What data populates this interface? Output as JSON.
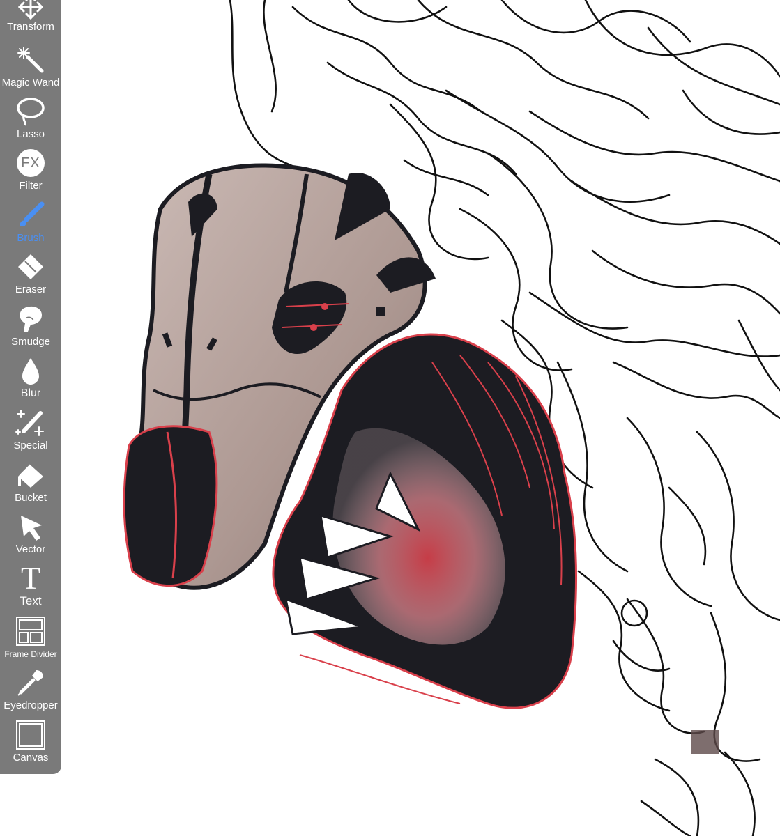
{
  "toolbar": {
    "tools": [
      {
        "label": "Transform",
        "icon": "transform-arrows-icon",
        "active": false
      },
      {
        "label": "Magic Wand",
        "icon": "magic-wand-icon",
        "active": false
      },
      {
        "label": "Lasso",
        "icon": "lasso-icon",
        "active": false
      },
      {
        "label": "Filter",
        "icon": "fx-filter-icon",
        "active": false
      },
      {
        "label": "Brush",
        "icon": "brush-icon",
        "active": true
      },
      {
        "label": "Eraser",
        "icon": "eraser-icon",
        "active": false
      },
      {
        "label": "Smudge",
        "icon": "smudge-finger-icon",
        "active": false
      },
      {
        "label": "Blur",
        "icon": "blur-drop-icon",
        "active": false
      },
      {
        "label": "Special",
        "icon": "special-pen-icon",
        "active": false
      },
      {
        "label": "Bucket",
        "icon": "bucket-icon",
        "active": false
      },
      {
        "label": "Vector",
        "icon": "vector-arrow-icon",
        "active": false
      },
      {
        "label": "Text",
        "icon": "text-t-icon",
        "active": false
      },
      {
        "label": "Frame Divider",
        "icon": "frame-divider-icon",
        "active": false
      },
      {
        "label": "Eyedropper",
        "icon": "eyedropper-icon",
        "active": false
      },
      {
        "label": "Canvas",
        "icon": "canvas-square-icon",
        "active": false
      }
    ],
    "filter_icon_text": "FX",
    "text_icon_glyph": "T"
  },
  "colors": {
    "toolbar_bg": "#7a7a7a",
    "active_tool": "#4a8ff2",
    "label": "#ffffff",
    "armor_beige": "#b9a8a2",
    "armor_dark": "#1c1c22",
    "accent_red": "#d9404b"
  }
}
